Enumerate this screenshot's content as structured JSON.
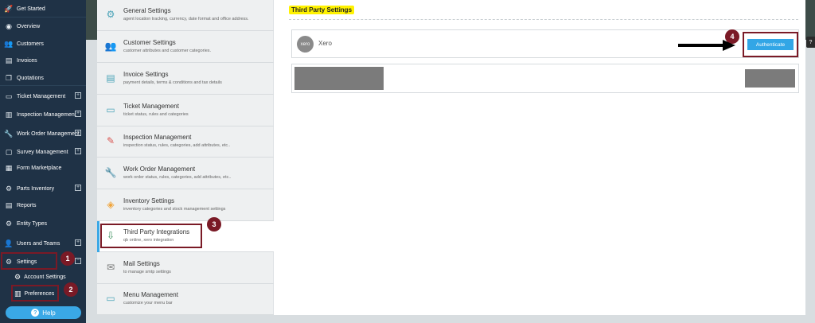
{
  "sidebar": {
    "items": [
      {
        "label": "Get Started",
        "icon": "rocket-icon",
        "glyph": "🚀"
      },
      {
        "label": "Overview",
        "icon": "globe-icon",
        "glyph": "◉"
      },
      {
        "label": "Customers",
        "icon": "customers-icon",
        "glyph": "👥"
      },
      {
        "label": "Invoices",
        "icon": "invoice-icon",
        "glyph": "▤"
      },
      {
        "label": "Quotations",
        "icon": "quotation-icon",
        "glyph": "❐"
      },
      {
        "label": "Ticket Management",
        "icon": "ticket-icon",
        "glyph": "▭"
      },
      {
        "label": "Inspection Management",
        "icon": "inspection-icon",
        "glyph": "▥"
      },
      {
        "label": "Work Order Management",
        "icon": "wrench-icon",
        "glyph": "🔧"
      },
      {
        "label": "Survey Management",
        "icon": "survey-icon",
        "glyph": "▢"
      },
      {
        "label": "Form Marketplace",
        "icon": "form-icon",
        "glyph": "▦"
      },
      {
        "label": "Parts Inventory",
        "icon": "parts-icon",
        "glyph": "⚙"
      },
      {
        "label": "Reports",
        "icon": "reports-icon",
        "glyph": "▤"
      },
      {
        "label": "Entity Types",
        "icon": "entity-icon",
        "glyph": "⚙"
      },
      {
        "label": "Users and Teams",
        "icon": "users-icon",
        "glyph": "👤"
      },
      {
        "label": "Settings",
        "icon": "settings-icon",
        "glyph": "⚙"
      }
    ],
    "sub_items": [
      {
        "label": "Account Settings",
        "icon": "account-settings-icon",
        "glyph": "⚙"
      },
      {
        "label": "Preferences",
        "icon": "preferences-icon",
        "glyph": "▥"
      }
    ],
    "help_label": "Help",
    "help_glyph": "?"
  },
  "settings_menu": [
    {
      "title": "General Settings",
      "desc": "agent location tracking, currency, date format and office address.",
      "icon": "gear-icon",
      "glyph": "⚙"
    },
    {
      "title": "Customer Settings",
      "desc": "customer attributes and customer categories.",
      "icon": "customers-icon",
      "glyph": "👥"
    },
    {
      "title": "Invoice Settings",
      "desc": "payment details, terms & conditions and tax details",
      "icon": "invoice-icon",
      "glyph": "▤"
    },
    {
      "title": "Ticket Management",
      "desc": "ticket status, rules and categories",
      "icon": "ticket-icon",
      "glyph": "▭"
    },
    {
      "title": "Inspection Management",
      "desc": "inspection status, rules, categories, add attributes, etc..",
      "icon": "inspection-icon",
      "glyph": "✎"
    },
    {
      "title": "Work Order Management",
      "desc": "work order status, rules, categories, add attributes, etc..",
      "icon": "wrench-icon",
      "glyph": "🔧"
    },
    {
      "title": "Inventory Settings",
      "desc": "inventory categories and stock management settings",
      "icon": "box-icon",
      "glyph": "◈"
    },
    {
      "title": "Third Party Integrations",
      "desc": "qb online, xero integration",
      "icon": "integration-icon",
      "glyph": "⇩"
    },
    {
      "title": "Mail Settings",
      "desc": "to manage smtp settings",
      "icon": "mail-icon",
      "glyph": "✉"
    },
    {
      "title": "Menu Management",
      "desc": "customize your menu bar",
      "icon": "menu-icon",
      "glyph": "▭"
    }
  ],
  "main": {
    "title": "Third Party Settings",
    "xero": {
      "logo_text": "xero",
      "name": "Xero",
      "button": "Authenticate"
    }
  },
  "badges": [
    "1",
    "2",
    "3",
    "4"
  ],
  "right_help_glyph": "?",
  "colors": {
    "sidebar_bg": "#1f3246",
    "accent": "#32a6e6",
    "highlight": "#7a1a26",
    "title_highlight": "#fff200"
  }
}
